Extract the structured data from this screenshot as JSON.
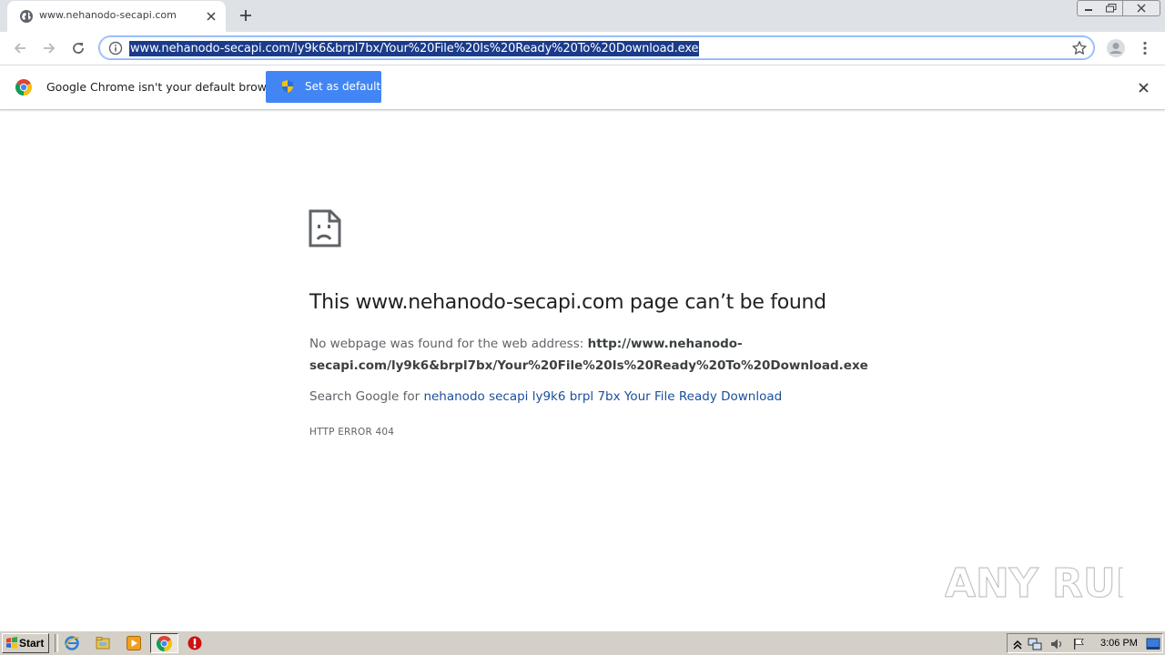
{
  "browser": {
    "tab": {
      "title": "www.nehanodo-secapi.com"
    },
    "address_bar": {
      "url": "www.nehanodo-secapi.com/ly9k6&brpl7bx/Your%20File%20Is%20Ready%20To%20Download.exe"
    },
    "infobar": {
      "message": "Google Chrome isn't your default browser",
      "button_label": "Set as default"
    }
  },
  "page": {
    "title": "This www.nehanodo-secapi.com page can’t be found",
    "no_webpage_prefix": "No webpage was found for the web address: ",
    "url_line1": "http://www.nehanodo-",
    "url_line2": "secapi.com/ly9k6&brpl7bx/Your%20File%20Is%20Ready%20To%20Download.exe",
    "search_prefix": "Search Google for ",
    "search_link": "nehanodo secapi ly9k6 brpl 7bx Your File Ready Download",
    "http_error": "HTTP ERROR 404"
  },
  "taskbar": {
    "start_label": "Start",
    "clock": "3:06 PM"
  },
  "watermark": {
    "text": "ANY RUN"
  },
  "colors": {
    "accent": "#4285f4",
    "link": "#1a4f9c",
    "selection": "#1a3b8a"
  }
}
